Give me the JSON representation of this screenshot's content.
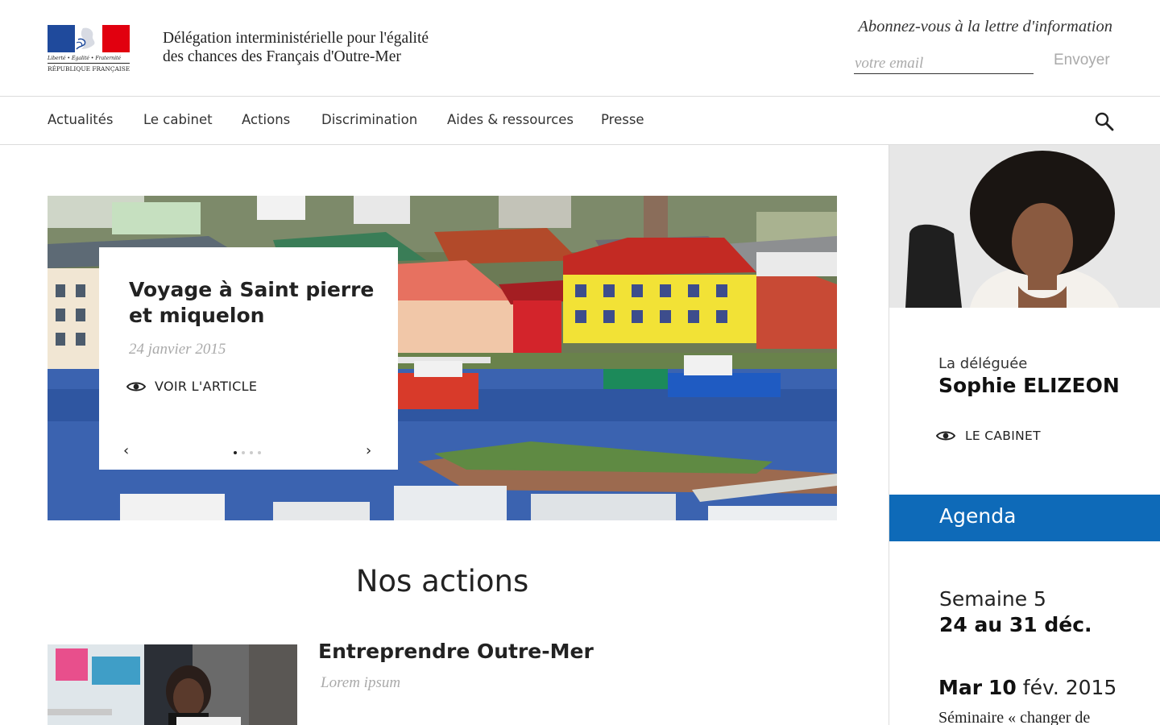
{
  "header": {
    "logo": {
      "motto": "Liberté • Égalité • Fraternité",
      "republic": "RÉPUBLIQUE FRANÇAISE"
    },
    "title_line1": "Délégation interministérielle pour l'égalité",
    "title_line2": "des chances des Français d'Outre-Mer",
    "newsletter": {
      "label": "Abonnez-vous à la lettre d'information",
      "placeholder": "votre email",
      "value": "",
      "button": "Envoyer"
    }
  },
  "nav": {
    "items": [
      "Actualités",
      "Le cabinet",
      "Actions",
      "Discrimination",
      "Aides & ressources",
      "Presse"
    ],
    "search_icon": "search-icon"
  },
  "carousel": {
    "title": "Voyage à Saint pierre et miquelon",
    "date": "24 janvier 2015",
    "link": "VOIR L'ARTICLE",
    "prev": "‹",
    "next": "›",
    "slide_count": 4,
    "active_index": 0
  },
  "actions": {
    "section_title": "Nos actions",
    "items": [
      {
        "title": "Entreprendre Outre-Mer",
        "subtitle": "Lorem ipsum"
      }
    ]
  },
  "sidebar": {
    "role": "La déléguée",
    "name": "Sophie ELIZEON",
    "link": "LE CABINET",
    "agenda": {
      "title": "Agenda",
      "week": "Semaine 5",
      "range": "24 au 31 déc.",
      "event_weekday": "Mar",
      "event_day": "10",
      "event_month_year": "fév. 2015",
      "event_text": "Séminaire « changer de"
    }
  },
  "colors": {
    "agenda_blue": "#0e6ab8",
    "flag_blue": "#1f4a9c",
    "flag_red": "#e1000f"
  }
}
